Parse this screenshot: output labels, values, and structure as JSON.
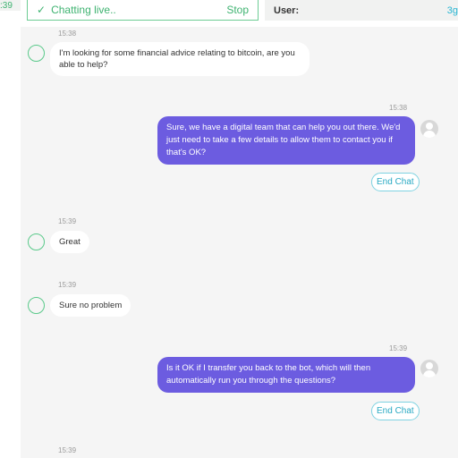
{
  "left_panel": {
    "time_fragment": ":39"
  },
  "status": {
    "check_icon": "checkmark-icon",
    "label": "Chatting live..",
    "stop_label": "Stop"
  },
  "user": {
    "label": "User:",
    "value_fragment": "3g"
  },
  "messages": [
    {
      "direction": "incoming",
      "time": "15:38",
      "text": "I'm looking for some financial advice relating to bitcoin, are you able to help?"
    },
    {
      "direction": "outgoing",
      "time": "15:38",
      "text": "Sure, we have a digital team that can help you out there. We'd just need to take a few details to allow them to contact you if that's OK?",
      "action_label": "End Chat"
    },
    {
      "direction": "incoming",
      "time": "15:39",
      "text": "Great"
    },
    {
      "direction": "incoming",
      "time": "15:39",
      "text": "Sure no problem"
    },
    {
      "direction": "outgoing",
      "time": "15:39",
      "text": "Is it OK if I transfer you back to the bot, which will then automatically run you through the questions?",
      "action_label": "End Chat"
    },
    {
      "direction": "incoming",
      "time": "15:39",
      "text": ""
    }
  ],
  "colors": {
    "accent_green": "#3fb371",
    "outgoing_bubble": "#6c5ce0",
    "end_chat_teal": "#29a9c3"
  }
}
